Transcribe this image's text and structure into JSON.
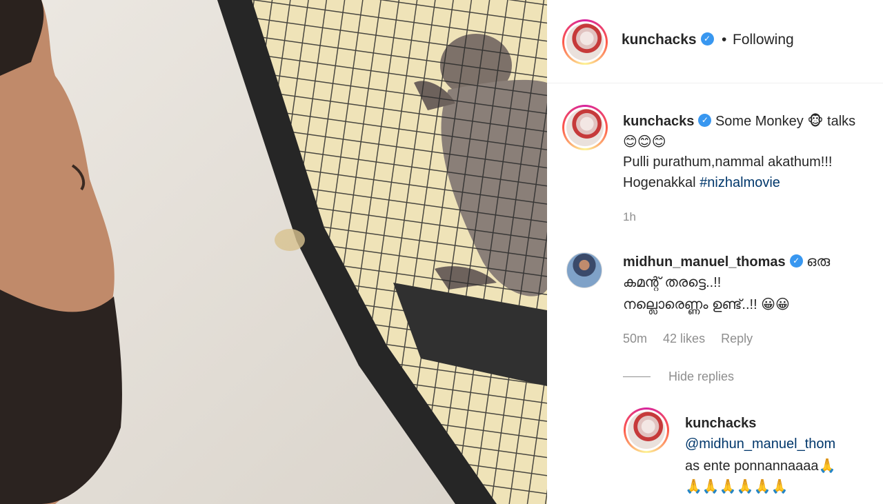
{
  "post": {
    "username": "kunchacks",
    "separator": "•",
    "follow_status": "Following",
    "verified_icon": "verified-badge-icon"
  },
  "caption": {
    "username": "kunchacks",
    "text_line1": "Some Monkey 🐵 talks",
    "text_line2": "😊😊😊",
    "text_line3": "Pulli purathum,nammal akathum!!!",
    "text_line4_prefix": "Hogenakkal ",
    "hashtag": "#nizhalmovie",
    "time": "1h"
  },
  "comment": {
    "username": "midhun_manuel_thomas",
    "text_line1": "ഒരു",
    "text_line2": "കമന്റ് തരട്ടെ..!!",
    "text_line3": "നല്ലൊരെണ്ണം ഉണ്ട്..!! 😀😀",
    "time": "50m",
    "likes": "42 likes",
    "reply_label": "Reply",
    "hide_replies": "Hide replies"
  },
  "reply": {
    "username": "kunchacks",
    "text_line1": "@midhun_manuel_thom",
    "text_line2": "as ente ponnannaaaa🙏",
    "text_line3": "🙏🙏🙏🙏🙏🙏"
  },
  "colors": {
    "link": "#00376b",
    "verified": "#3897f0",
    "muted": "#8e8e8e",
    "text": "#262626"
  }
}
